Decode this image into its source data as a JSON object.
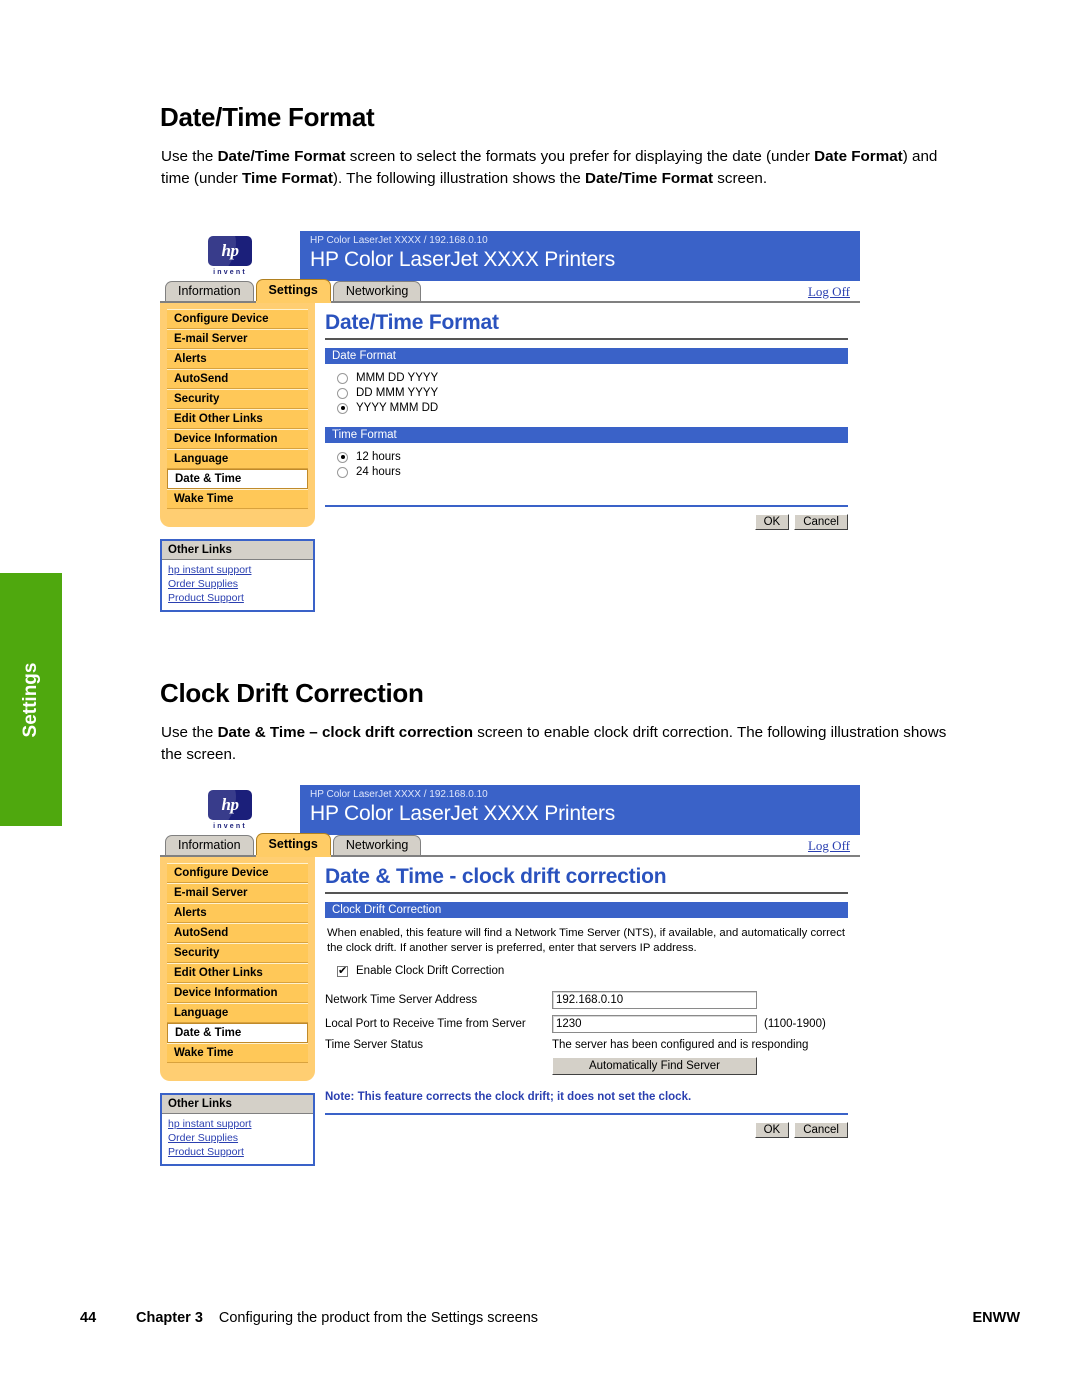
{
  "side_tab": {
    "label": "Settings"
  },
  "sections": [
    {
      "heading": "Date/Time Format",
      "para_html": "Use the <b>Date/Time Format</b> screen to select the formats you prefer for displaying the date (under <b>Date Format</b>) and time (under <b>Time Format</b>). The following illustration shows the <b>Date/Time Format</b> screen."
    },
    {
      "heading": "Clock Drift Correction",
      "para_html": "Use the <b>Date &amp; Time &ndash; clock drift correction</b> screen to enable clock drift correction. The following illustration shows the screen."
    }
  ],
  "ews": {
    "logo": {
      "wordmark": "hp",
      "tagline": "invent"
    },
    "header": {
      "breadcrumb": "HP Color LaserJet XXXX / 192.168.0.10",
      "title": "HP Color LaserJet XXXX Printers"
    },
    "tabs": [
      {
        "label": "Information",
        "active": false
      },
      {
        "label": "Settings",
        "active": true
      },
      {
        "label": "Networking",
        "active": false
      }
    ],
    "logoff_label": "Log Off",
    "nav_items": [
      {
        "label": "Configure Device",
        "selected": false
      },
      {
        "label": "E-mail Server",
        "selected": false
      },
      {
        "label": "Alerts",
        "selected": false
      },
      {
        "label": "AutoSend",
        "selected": false
      },
      {
        "label": "Security",
        "selected": false
      },
      {
        "label": "Edit Other Links",
        "selected": false
      },
      {
        "label": "Device Information",
        "selected": false
      },
      {
        "label": "Language",
        "selected": false
      },
      {
        "label": "Date & Time",
        "selected": true
      },
      {
        "label": "Wake Time",
        "selected": false
      }
    ],
    "other_links": {
      "heading": "Other Links",
      "links": [
        "hp instant support",
        "Order Supplies",
        "Product Support"
      ]
    },
    "buttons": {
      "ok": "OK",
      "cancel": "Cancel"
    }
  },
  "screen1": {
    "page_title": "Date/Time Format",
    "date_format": {
      "bar": "Date Format",
      "options": [
        {
          "label": "MMM DD YYYY",
          "selected": false
        },
        {
          "label": "DD MMM YYYY",
          "selected": false
        },
        {
          "label": "YYYY MMM DD",
          "selected": true
        }
      ]
    },
    "time_format": {
      "bar": "Time Format",
      "options": [
        {
          "label": "12 hours",
          "selected": true
        },
        {
          "label": "24 hours",
          "selected": false
        }
      ]
    }
  },
  "screen2": {
    "page_title": "Date & Time - clock drift correction",
    "bar": "Clock Drift Correction",
    "description": "When enabled, this feature will find a Network Time Server (NTS), if available, and automatically correct the clock drift. If another server is preferred, enter that servers IP address.",
    "enable_checkbox": {
      "label": "Enable Clock Drift Correction",
      "checked": true
    },
    "fields": [
      {
        "label": "Network Time Server Address",
        "value": "192.168.0.10",
        "hint": ""
      },
      {
        "label": "Local Port to Receive Time from Server",
        "value": "1230",
        "hint": "(1100-1900)"
      }
    ],
    "status": {
      "label": "Time Server Status",
      "value": "The server has been configured and is responding"
    },
    "find_button": "Automatically Find Server",
    "note": "Note: This feature corrects the clock drift; it does not set the clock."
  },
  "footer": {
    "page_number": "44",
    "chapter": "Chapter 3",
    "chapter_title": "Configuring the product from the Settings screens",
    "edition": "ENWW"
  },
  "colors": {
    "header_blue": "#3a62c8",
    "nav_orange": "#FFCE72",
    "active_tab": "#ffcc66",
    "green_tab": "#4FA80E",
    "link_blue": "#2a3fb0"
  }
}
